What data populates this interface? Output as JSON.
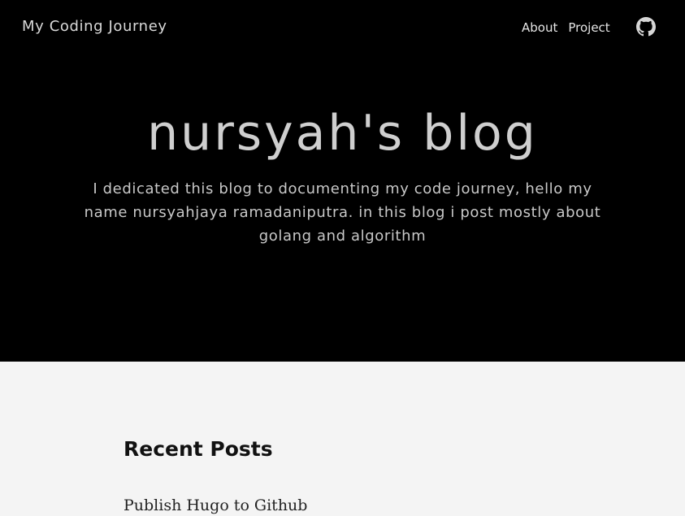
{
  "nav": {
    "site_title": "My Coding Journey",
    "links": [
      {
        "label": "About"
      },
      {
        "label": "Project"
      }
    ],
    "github_icon": "github-icon"
  },
  "hero": {
    "title": "nursyah's blog",
    "subtitle": "I dedicated this blog to documenting my code journey, hello my name nursyahjaya ramadaniputra. in this blog i post mostly about golang and algorithm"
  },
  "recent_posts": {
    "heading": "Recent Posts",
    "posts": [
      {
        "title": "Publish Hugo to Github"
      }
    ]
  },
  "colors": {
    "hero_background": "#000000",
    "page_background": "#f4f4f4"
  }
}
